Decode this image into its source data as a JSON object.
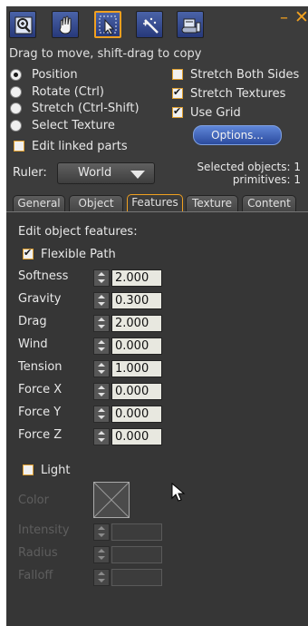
{
  "window": {
    "minimize_glyph": "–",
    "close_glyph": "✕"
  },
  "toolbar": {
    "tools": [
      {
        "name": "zoom-tool",
        "icon": "magnifier-icon"
      },
      {
        "name": "grab-tool",
        "icon": "hand-icon"
      },
      {
        "name": "edit-tool",
        "icon": "pointer-icon",
        "active": true
      },
      {
        "name": "create-tool",
        "icon": "wand-icon"
      },
      {
        "name": "land-tool",
        "icon": "bulldozer-icon"
      }
    ],
    "hint": "Drag to move, shift-drag to copy"
  },
  "modes": {
    "position": "Position",
    "rotate": "Rotate (Ctrl)",
    "stretch": "Stretch (Ctrl-Shift)",
    "select_texture": "Select Texture",
    "selected": "Position"
  },
  "options": {
    "stretch_both_sides": {
      "label": "Stretch Both Sides",
      "checked": false
    },
    "stretch_textures": {
      "label": "Stretch Textures",
      "checked": true
    },
    "use_grid": {
      "label": "Use Grid",
      "checked": true
    },
    "options_button": "Options...",
    "edit_linked_parts": {
      "label": "Edit linked parts",
      "checked": false
    }
  },
  "ruler": {
    "label": "Ruler:",
    "value": "World"
  },
  "selection": {
    "objects": "Selected objects: 1",
    "primitives": "primitives: 1"
  },
  "tabs": {
    "general": "General",
    "object": "Object",
    "features": "Features",
    "texture": "Texture",
    "content": "Content",
    "active": "Features"
  },
  "features": {
    "heading": "Edit object features:",
    "flexible_path": {
      "label": "Flexible Path",
      "checked": true
    },
    "softness": {
      "label": "Softness",
      "value": "2.000"
    },
    "gravity": {
      "label": "Gravity",
      "value": "0.300"
    },
    "drag": {
      "label": "Drag",
      "value": "2.000"
    },
    "wind": {
      "label": "Wind",
      "value": "0.000"
    },
    "tension": {
      "label": "Tension",
      "value": "1.000"
    },
    "force_x": {
      "label": "Force X",
      "value": "0.000"
    },
    "force_y": {
      "label": "Force Y",
      "value": "0.000"
    },
    "force_z": {
      "label": "Force Z",
      "value": "0.000"
    },
    "light": {
      "label": "Light",
      "checked": false
    },
    "color": {
      "label": "Color"
    },
    "intensity": {
      "label": "Intensity",
      "value": ""
    },
    "radius": {
      "label": "Radius",
      "value": ""
    },
    "falloff": {
      "label": "Falloff",
      "value": ""
    }
  },
  "colors": {
    "panel_bg": "#3c3c3c",
    "accent": "#f0a020",
    "tool_blue": "#3a4f96"
  }
}
